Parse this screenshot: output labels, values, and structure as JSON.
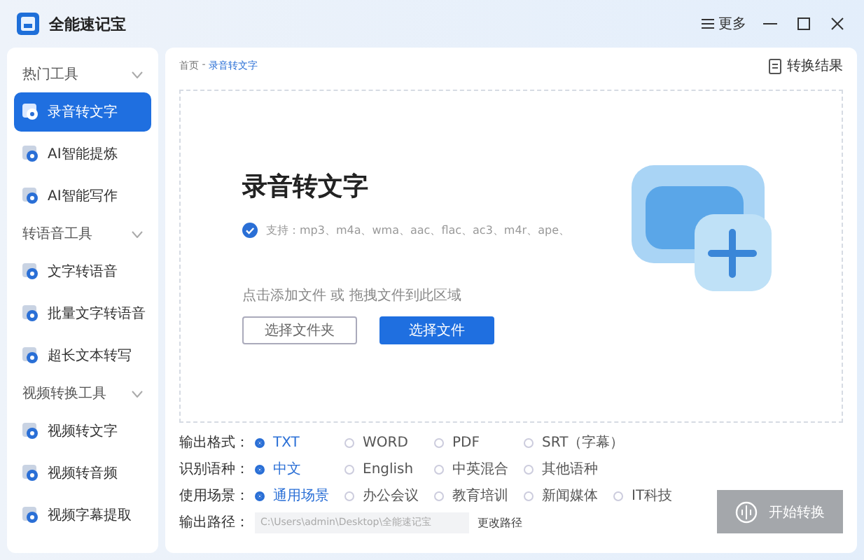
{
  "window": {
    "title": "全能速记宝",
    "more": "更多"
  },
  "sidebar": {
    "groups": [
      {
        "title": "热门工具",
        "items": [
          {
            "label": "录音转文字",
            "selected": true
          },
          {
            "label": "AI智能提炼",
            "selected": false
          },
          {
            "label": "AI智能写作",
            "selected": false
          }
        ]
      },
      {
        "title": "转语音工具",
        "items": [
          {
            "label": "文字转语音",
            "selected": false
          },
          {
            "label": "批量文字转语音",
            "selected": false
          },
          {
            "label": "超长文本转写",
            "selected": false
          }
        ]
      },
      {
        "title": "视频转换工具",
        "items": [
          {
            "label": "视频转文字",
            "selected": false
          },
          {
            "label": "视频转音频",
            "selected": false
          },
          {
            "label": "视频字幕提取",
            "selected": false
          }
        ]
      }
    ]
  },
  "main": {
    "breadcrumb": {
      "home": "首页",
      "sep": " - ",
      "current": "录音转文字"
    },
    "result_link": "转换结果",
    "upload": {
      "heading": "录音转文字",
      "formats": "支持：mp3、m4a、wma、aac、flac、ac3、m4r、ape、",
      "hint": "点击添加文件 或 拖拽文件到此区域",
      "buttons": [
        {
          "label": "选择文件夹",
          "kind": "outline"
        },
        {
          "label": "选择文件",
          "kind": "primary"
        }
      ]
    },
    "options": [
      {
        "label": "输出格式：",
        "choices": [
          {
            "label": "TXT",
            "selected": true
          },
          {
            "label": "WORD",
            "selected": false
          },
          {
            "label": "PDF",
            "selected": false
          },
          {
            "label": "SRT（字幕）",
            "selected": false
          }
        ]
      },
      {
        "label": "识别语种：",
        "choices": [
          {
            "label": "中文",
            "selected": true
          },
          {
            "label": "English",
            "selected": false
          },
          {
            "label": "中英混合",
            "selected": false
          },
          {
            "label": "其他语种",
            "selected": false
          }
        ]
      },
      {
        "label": "使用场景：",
        "choices": [
          {
            "label": "通用场景",
            "selected": true
          },
          {
            "label": "办公会议",
            "selected": false
          },
          {
            "label": "教育培训",
            "selected": false
          },
          {
            "label": "新闻媒体",
            "selected": false
          },
          {
            "label": "IT科技",
            "selected": false
          }
        ]
      }
    ],
    "output_path": {
      "label": "输出路径：",
      "value": "C:\\Users\\admin\\Desktop\\全能速记宝",
      "change": "更改路径"
    },
    "start_button": {
      "label": "开始转换",
      "disabled": true
    }
  }
}
